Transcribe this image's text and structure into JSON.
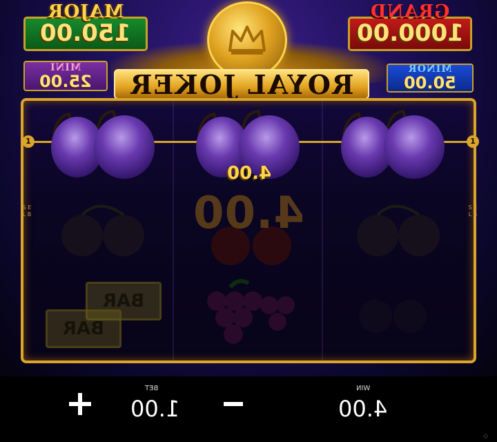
{
  "jackpots": {
    "major": {
      "label": "MAJOR",
      "value": "150.00"
    },
    "grand": {
      "label": "GRAND",
      "value": "1000.00"
    },
    "mini": {
      "label": "MINI",
      "value": "25.00"
    },
    "minor": {
      "label": "MINOR",
      "value": "50.00"
    }
  },
  "logo": {
    "title": "ROYAL JOKER"
  },
  "reels": {
    "payline_number": "1",
    "side_text": "S E L B",
    "line_win": "4.00",
    "total_win_big": "4.00",
    "bar_label": "BAR"
  },
  "controls": {
    "bet_caption": "BET",
    "bet_value": "1.00",
    "win_caption": "WIN",
    "win_value": "4.00",
    "plus_symbol": "+",
    "minus_symbol": "−"
  },
  "colors": {
    "gold": "#d9a52a",
    "major_green": "#168a2c",
    "grand_red": "#c21a1a",
    "mini_purple": "#7a2fa0",
    "minor_blue": "#1a4ad8",
    "plum_purple": "#5a2a9a"
  },
  "icons": {
    "crown": "crown-icon",
    "plum": "plum-icon",
    "cherry": "cherry-icon",
    "grapes": "grapes-icon",
    "bar": "bar-icon"
  }
}
